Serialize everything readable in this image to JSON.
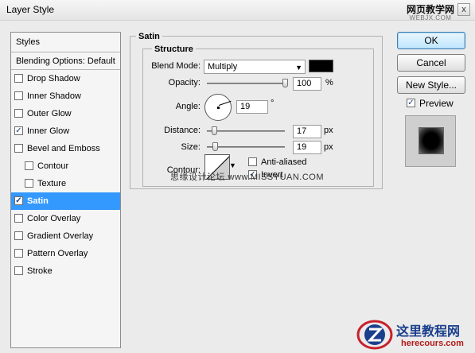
{
  "window": {
    "title": "Layer Style",
    "close_label": "x"
  },
  "watermarks": {
    "top_main": "网页教学网",
    "top_sub": "WEBJX.COM",
    "middle": "思缘设计论坛 www.MISSYUAN.COM",
    "bottom_main": "这里教程网",
    "bottom_url": "herecours.com"
  },
  "styles_list": {
    "header": "Styles",
    "blending": "Blending Options: Default",
    "items": [
      {
        "label": "Drop Shadow",
        "checked": false
      },
      {
        "label": "Inner Shadow",
        "checked": false
      },
      {
        "label": "Outer Glow",
        "checked": false
      },
      {
        "label": "Inner Glow",
        "checked": true
      },
      {
        "label": "Bevel and Emboss",
        "checked": false
      },
      {
        "label": "Contour",
        "checked": false
      },
      {
        "label": "Texture",
        "checked": false
      },
      {
        "label": "Satin",
        "checked": true
      },
      {
        "label": "Color Overlay",
        "checked": false
      },
      {
        "label": "Gradient Overlay",
        "checked": false
      },
      {
        "label": "Pattern Overlay",
        "checked": false
      },
      {
        "label": "Stroke",
        "checked": false
      }
    ]
  },
  "satin": {
    "title": "Satin",
    "structure_title": "Structure",
    "blend_mode_label": "Blend Mode:",
    "blend_mode_value": "Multiply",
    "blend_color": "#000000",
    "opacity_label": "Opacity:",
    "opacity_value": "100",
    "opacity_unit": "%",
    "opacity_fraction": 1.0,
    "angle_label": "Angle:",
    "angle_value": "19",
    "angle_unit": "°",
    "distance_label": "Distance:",
    "distance_value": "17",
    "distance_unit": "px",
    "distance_fraction": 0.07,
    "size_label": "Size:",
    "size_value": "19",
    "size_unit": "px",
    "size_fraction": 0.08,
    "contour_label": "Contour:",
    "anti_aliased_label": "Anti-aliased",
    "anti_aliased_checked": false,
    "invert_label": "Invert",
    "invert_checked": true
  },
  "buttons": {
    "ok": "OK",
    "cancel": "Cancel",
    "new_style": "New Style...",
    "preview_label": "Preview",
    "preview_checked": true
  },
  "colors": {
    "selection": "#3399ff",
    "preview_bg": "#cfcfcf"
  }
}
